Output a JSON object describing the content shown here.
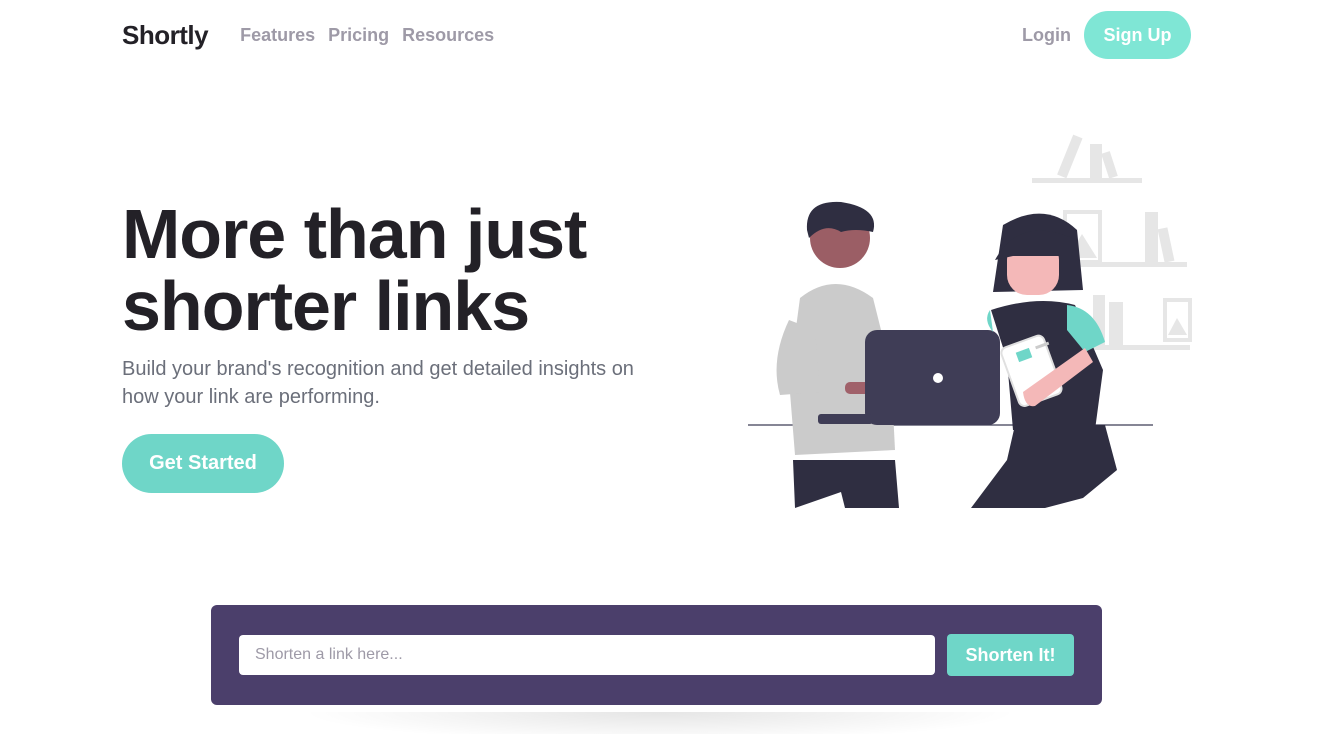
{
  "nav": {
    "logo": "Shortly",
    "links": [
      "Features",
      "Pricing",
      "Resources"
    ],
    "login": "Login",
    "signup": "Sign Up"
  },
  "hero": {
    "title_line1": "More than just",
    "title_line2": "shorter links",
    "subtitle": "Build your brand's recognition and get detailed insights on how your link are performing.",
    "cta": "Get Started",
    "illustration": "people-working-illustration"
  },
  "shorten": {
    "placeholder": "Shorten a link here...",
    "value": "",
    "button": "Shorten It!"
  },
  "colors": {
    "accent": "#6fd6c8",
    "accent_light": "#7fe6d5",
    "dark_violet": "#4b3f6b",
    "heading": "#232127",
    "muted": "#9e9aa7"
  }
}
